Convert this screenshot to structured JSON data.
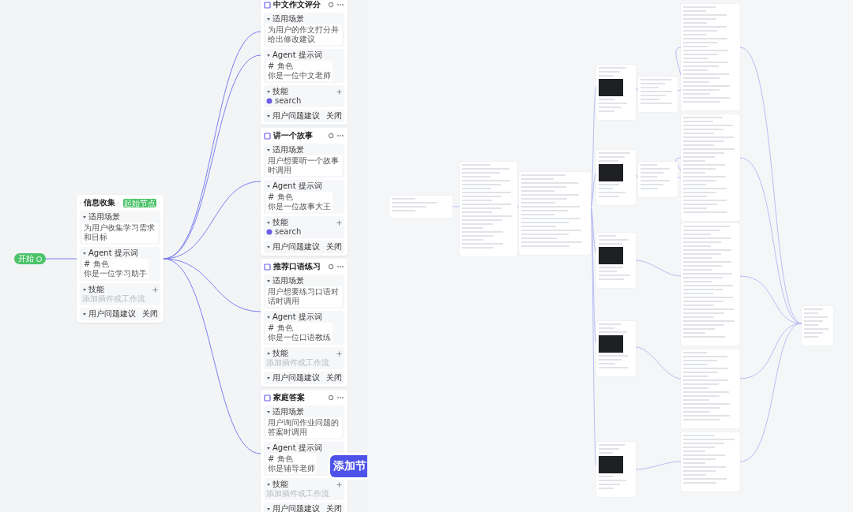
{
  "start": {
    "label": "开始"
  },
  "agents": [
    {
      "title": "信息收集",
      "tag": "起始节点",
      "scenario_label": "适用场景",
      "scenario": "为用户收集学习需求和目标",
      "prompt_label": "Agent 提示词",
      "prompt_heading": "# 角色",
      "prompt": "你是一位学习助手",
      "skills_label": "技能",
      "skills_placeholder": "添加插件或工作流",
      "suggest_label": "用户问题建议",
      "suggest_value": "关闭"
    },
    {
      "title": "中文作文评分",
      "scenario_label": "适用场景",
      "scenario": "为用户的作文打分并给出修改建议",
      "prompt_label": "Agent 提示词",
      "prompt_heading": "# 角色",
      "prompt": "你是一位中文老师",
      "skills_label": "技能",
      "skills": [
        "search"
      ],
      "suggest_label": "用户问题建议",
      "suggest_value": "关闭"
    },
    {
      "title": "讲一个故事",
      "scenario_label": "适用场景",
      "scenario": "用户想要听一个故事时调用",
      "prompt_label": "Agent 提示词",
      "prompt_heading": "# 角色",
      "prompt": "你是一位故事大王",
      "skills_label": "技能",
      "skills": [
        "search"
      ],
      "suggest_label": "用户问题建议",
      "suggest_value": "关闭"
    },
    {
      "title": "推荐口语练习",
      "scenario_label": "适用场景",
      "scenario": "用户想要练习口语对话时调用",
      "prompt_label": "Agent 提示词",
      "prompt_heading": "# 角色",
      "prompt": "你是一位口语教练",
      "skills_label": "技能",
      "skills_placeholder": "添加插件或工作流",
      "suggest_label": "用户问题建议",
      "suggest_value": "关闭"
    },
    {
      "title": "家庭答案",
      "scenario_label": "适用场景",
      "scenario": "用户询问作业问题的答案时调用",
      "prompt_label": "Agent 提示词",
      "prompt_heading": "# 角色",
      "prompt": "你是辅导老师",
      "skills_label": "技能",
      "skills_placeholder": "添加插件或工作流",
      "suggest_label": "用户问题建议",
      "suggest_value": "关闭"
    }
  ],
  "add_button": {
    "label": "添加节"
  }
}
